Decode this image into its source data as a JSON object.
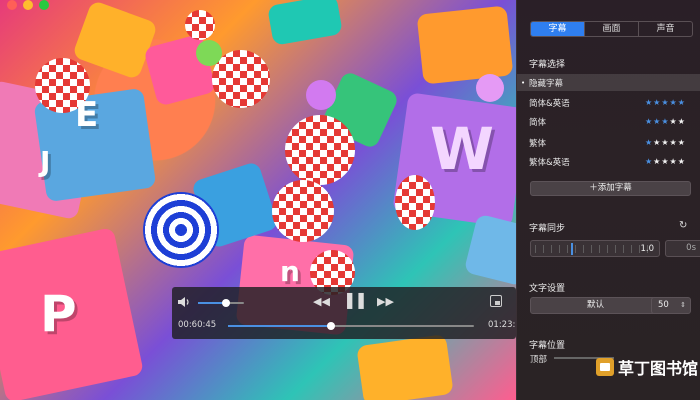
{
  "window": {
    "traffic_lights": [
      "#ff5f57",
      "#febc2e",
      "#28c840"
    ]
  },
  "menubar": {
    "icons": [
      "gear-icon",
      "caption-icon",
      "globe-icon",
      "menu-icon"
    ]
  },
  "player": {
    "time_current": "00:60:45",
    "time_total": "01:23:",
    "volume_level": 0.6,
    "seek_progress": 0.42,
    "colors": {
      "accent": "#4a90e2"
    }
  },
  "panel": {
    "tabs": [
      {
        "label": "字幕",
        "active": true
      },
      {
        "label": "画面",
        "active": false
      },
      {
        "label": "声音",
        "active": false
      }
    ],
    "subtitle_select_title": "字幕选择",
    "subtitle_options": [
      {
        "label": "隐藏字幕",
        "selected": true,
        "rating": null
      },
      {
        "label": "简体&英语",
        "selected": false,
        "rating": 5
      },
      {
        "label": "简体",
        "selected": false,
        "rating": 3
      },
      {
        "label": "繁体",
        "selected": false,
        "rating": 1
      },
      {
        "label": "繁体&英语",
        "selected": false,
        "rating": 1
      }
    ],
    "add_subtitle_label": "＋添加字幕",
    "sync_title": "字幕同步",
    "sync_value": "1.0",
    "sync_offset": "0s",
    "text_settings_title": "文字设置",
    "font_value": "默认",
    "font_size_value": "50",
    "position_title": "字幕位置",
    "position_label": "顶部"
  },
  "watermark": {
    "text": "草丁图书馆"
  }
}
